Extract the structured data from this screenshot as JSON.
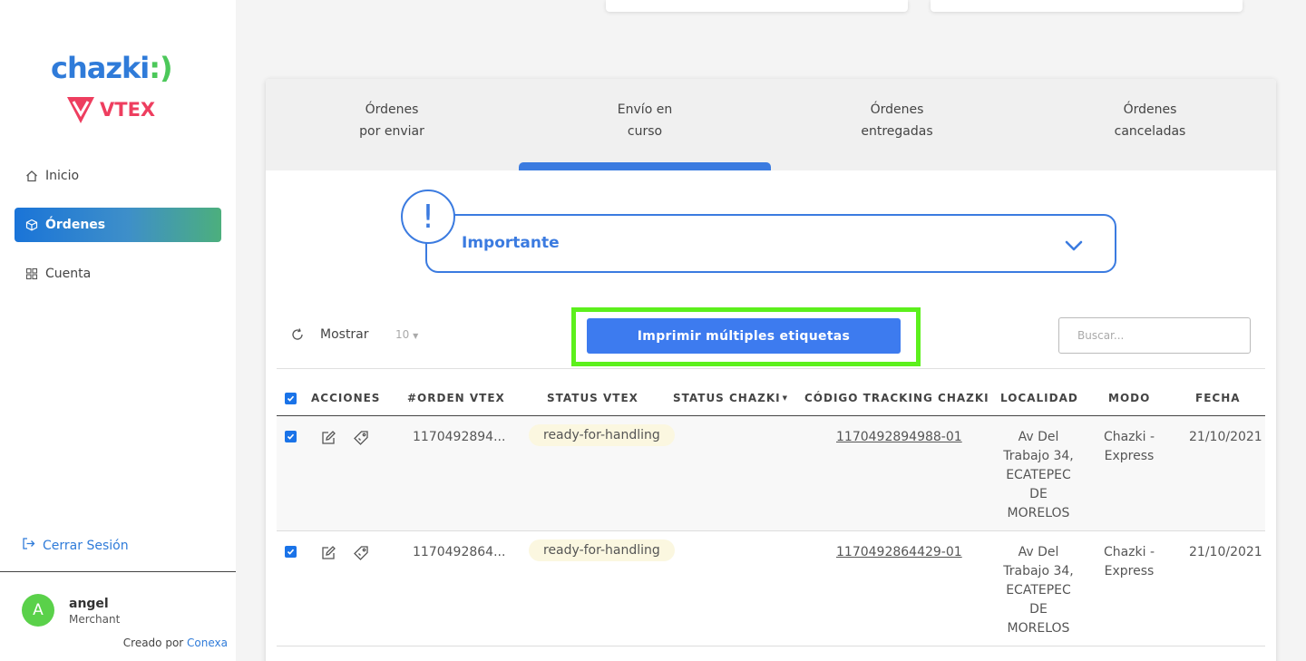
{
  "brand": {
    "logo_main": "chazki",
    "logo_partner": "VTEX"
  },
  "sidebar": {
    "items": [
      {
        "label": "Inicio",
        "icon": "home-icon"
      },
      {
        "label": "Órdenes",
        "icon": "box-icon",
        "active": true
      },
      {
        "label": "Cuenta",
        "icon": "grid-icon"
      }
    ],
    "logout_label": "Cerrar Sesión",
    "user": {
      "initial": "A",
      "name": "angel",
      "role": "Merchant"
    },
    "credits_prefix": "Creado por",
    "credits_link": "Conexa"
  },
  "tabs": [
    {
      "line1": "Órdenes",
      "line2": "por enviar"
    },
    {
      "line1": "Envío en",
      "line2": "curso",
      "active": true
    },
    {
      "line1": "Órdenes",
      "line2": "entregadas"
    },
    {
      "line1": "Órdenes",
      "line2": "canceladas"
    }
  ],
  "important": {
    "icon": "!",
    "title": "Importante"
  },
  "toolbar": {
    "show_label": "Mostrar",
    "show_value": "10",
    "print_label": "Imprimir múltiples etiquetas",
    "search_placeholder": "Buscar..."
  },
  "table": {
    "headers": {
      "acciones": "ACCIONES",
      "orden": "#ORDEN VTEX",
      "status_vtex": "STATUS VTEX",
      "status_chazki": "STATUS CHAZKI",
      "tracking": "CÓDIGO TRACKING CHAZKI",
      "localidad": "LOCALIDAD",
      "modo": "MODO",
      "fecha": "FECHA"
    },
    "rows": [
      {
        "orden": "1170492894...",
        "status_vtex": "ready-for-handling",
        "tracking": "1170492894988-01",
        "localidad": [
          "Av Del",
          "Trabajo 34,",
          "ECATEPEC",
          "DE",
          "MORELOS"
        ],
        "modo": [
          "Chazki -",
          "Express"
        ],
        "fecha": "21/10/2021"
      },
      {
        "orden": "1170492864...",
        "status_vtex": "ready-for-handling",
        "tracking": "1170492864429-01",
        "localidad": [
          "Av Del",
          "Trabajo 34,",
          "ECATEPEC",
          "DE",
          "MORELOS"
        ],
        "modo": [
          "Chazki -",
          "Express"
        ],
        "fecha": "21/10/2021"
      }
    ]
  },
  "colors": {
    "accent": "#3b7be0",
    "highlight": "#5cf01c",
    "brand_blue": "#2f7bd9",
    "brand_green": "#4cc85a",
    "vtex_pink": "#ee3e5f"
  }
}
